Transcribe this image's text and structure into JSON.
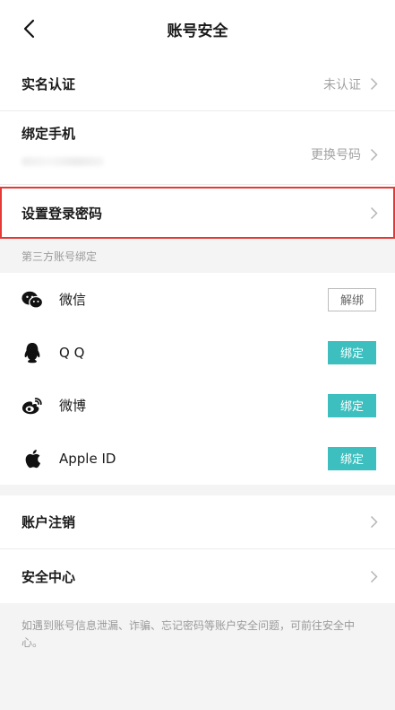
{
  "header": {
    "title": "账号安全",
    "back_icon": "chevron-left-icon"
  },
  "security": {
    "real_name": {
      "label": "实名认证",
      "value": "未认证"
    },
    "phone": {
      "label": "绑定手机",
      "action": "更换号码"
    },
    "login_password": {
      "label": "设置登录密码"
    }
  },
  "third_party": {
    "caption": "第三方账号绑定",
    "items": [
      {
        "name": "微信",
        "icon": "wechat-icon",
        "button": "解绑",
        "bound": true
      },
      {
        "name": "Q Q",
        "icon": "qq-icon",
        "button": "绑定",
        "bound": false
      },
      {
        "name": "微博",
        "icon": "weibo-icon",
        "button": "绑定",
        "bound": false
      },
      {
        "name": "Apple ID",
        "icon": "apple-icon",
        "button": "绑定",
        "bound": false
      }
    ]
  },
  "account": {
    "cancel": {
      "label": "账户注销"
    },
    "center": {
      "label": "安全中心"
    }
  },
  "footer": {
    "note": "如遇到账号信息泄漏、诈骗、忘记密码等账户安全问题，可前往安全中心。"
  },
  "colors": {
    "accent": "#3cbfbe",
    "highlight": "#e53935",
    "muted_text": "#9a9a9a",
    "background": "#f4f4f4"
  }
}
